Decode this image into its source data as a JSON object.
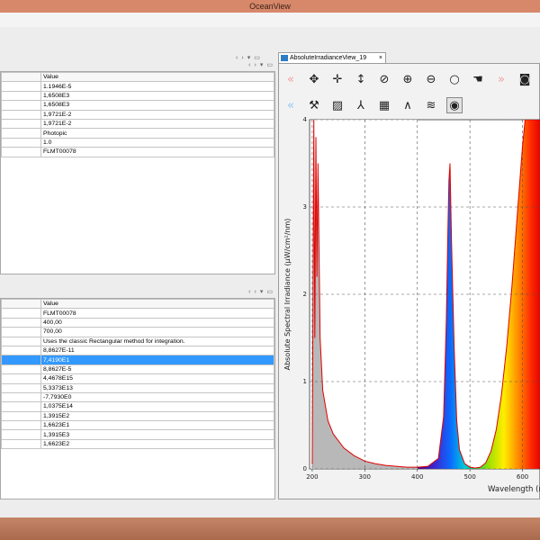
{
  "window": {
    "title": "OceanView"
  },
  "top_panel": {
    "value_header": "Value",
    "rows": [
      "1.1946E-5",
      "1,6508E3",
      "1,6508E3",
      "1,9721E-2",
      "1,9721E-2",
      "Photopic",
      "1.0",
      "FLMT00078"
    ]
  },
  "bottom_panel": {
    "value_header": "Value",
    "selected_index": 5,
    "rows": [
      "FLMT00078",
      "400,00",
      "700,00",
      "Uses the classic Rectangular method for integration.",
      "8,8627E-11",
      "7,4190E1",
      "8,8627E-5",
      "4,4678E15",
      "5,3373E13",
      "-7,7930E0",
      "1,0375E14",
      "1,3915E2",
      "1,6623E1",
      "1,3915E3",
      "1,6623E2"
    ]
  },
  "tab": {
    "label": "AbsoluteIrradianceView_19",
    "close": "×"
  },
  "panel_controls": {
    "left": "‹",
    "right": "›",
    "menu": "▾",
    "restore": "▭"
  },
  "toolbar_row1": [
    {
      "name": "back-icon",
      "glyph": "«"
    },
    {
      "name": "move-icon",
      "glyph": "✥"
    },
    {
      "name": "crosshair-icon",
      "glyph": "✛"
    },
    {
      "name": "vertical-arrow-icon",
      "glyph": "↕"
    },
    {
      "name": "zoom-region-icon",
      "glyph": "⊘"
    },
    {
      "name": "zoom-in-icon",
      "glyph": "⊕"
    },
    {
      "name": "zoom-out-icon",
      "glyph": "⊖"
    },
    {
      "name": "zoom-fit-icon",
      "glyph": "○"
    },
    {
      "name": "pan-hand-icon",
      "glyph": "☚"
    },
    {
      "name": "forward-icon",
      "glyph": "»"
    },
    {
      "name": "camera-icon",
      "glyph": "◙"
    }
  ],
  "toolbar_row2": [
    {
      "name": "collapse-icon",
      "glyph": "«"
    },
    {
      "name": "tools-icon",
      "glyph": "⚒"
    },
    {
      "name": "graph-window-icon",
      "glyph": "▨"
    },
    {
      "name": "peak-marker-icon",
      "glyph": "⅄"
    },
    {
      "name": "table-icon",
      "glyph": "▦"
    },
    {
      "name": "spectrum-peaks-icon",
      "glyph": "∧"
    },
    {
      "name": "overlay-icon",
      "glyph": "≋"
    },
    {
      "name": "lamp-icon",
      "glyph": "◉"
    }
  ],
  "chart_data": {
    "type": "line",
    "ylabel": "Absolute Spectral Irradiance (µW/cm²/nm)",
    "xlabel": "Wavelength (nm)",
    "xlim": [
      195,
      635
    ],
    "ylim": [
      0,
      4
    ],
    "x_ticks": [
      "200",
      "300",
      "400",
      "500",
      "600"
    ],
    "y_ticks": [
      "0",
      "1",
      "2",
      "3",
      "4"
    ],
    "grid": true,
    "series": [
      {
        "x": [
          200,
          203,
          205,
          207,
          209,
          211,
          213,
          215,
          220,
          230,
          240,
          260,
          280,
          300,
          320,
          340,
          360,
          380,
          400,
          420,
          440,
          450,
          455,
          458,
          460,
          462,
          465,
          470,
          475,
          480,
          490,
          500,
          510,
          520,
          530,
          540,
          550,
          560,
          570,
          580,
          590,
          600,
          605,
          610,
          620,
          635
        ],
        "y": [
          0.05,
          4.0,
          1.5,
          3.8,
          2.2,
          3.5,
          2.5,
          1.5,
          0.9,
          0.55,
          0.4,
          0.24,
          0.15,
          0.09,
          0.06,
          0.04,
          0.03,
          0.02,
          0.02,
          0.03,
          0.12,
          0.6,
          1.7,
          2.7,
          3.3,
          3.5,
          2.6,
          1.4,
          0.55,
          0.22,
          0.06,
          0.02,
          0.01,
          0.02,
          0.07,
          0.2,
          0.45,
          0.85,
          1.4,
          2.1,
          2.9,
          3.7,
          4.0,
          4.0,
          4.0,
          4.0
        ]
      }
    ]
  }
}
